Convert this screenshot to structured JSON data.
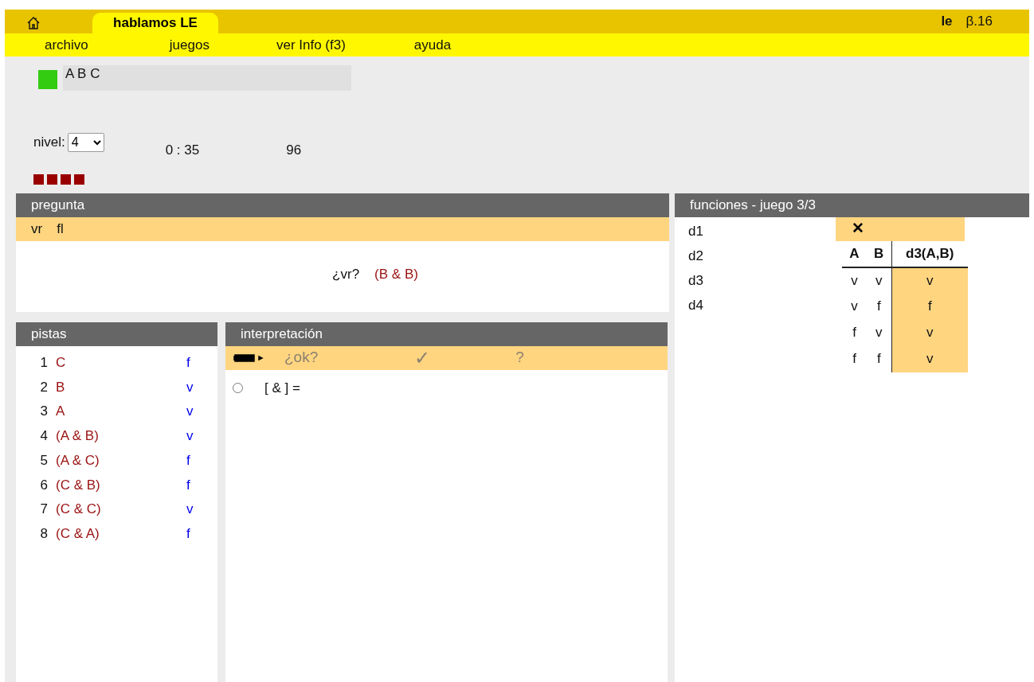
{
  "header": {
    "tabs": [
      {
        "kind": "home",
        "selected": false
      },
      {
        "kind": "text",
        "label": "hablamos LE",
        "selected": true
      }
    ],
    "user": "le",
    "version": "β.16"
  },
  "menu": [
    "archivo",
    "juegos",
    "ver Info (f3)",
    "ayuda"
  ],
  "status": {
    "solved": true,
    "letters": "A B C",
    "nivel_label": "nivel:",
    "nivel": "4",
    "time": "0 : 35",
    "score": "96",
    "squares": [
      {
        "filled": true
      },
      {
        "filled": true
      },
      {
        "filled": true
      },
      {
        "filled": true
      }
    ]
  },
  "pregunta": {
    "title": "pregunta",
    "tabs": [
      "vr",
      "fl"
    ],
    "question": "¿vr?",
    "formula": "(B & B)"
  },
  "pistas": {
    "title": "pistas",
    "items": [
      {
        "n": "1",
        "formula": "C",
        "value": "f"
      },
      {
        "n": "2",
        "formula": "B",
        "value": "v"
      },
      {
        "n": "3",
        "formula": "A",
        "value": "v"
      },
      {
        "n": "4",
        "formula": "(A & B)",
        "value": "v"
      },
      {
        "n": "5",
        "formula": "(A & C)",
        "value": "f"
      },
      {
        "n": "6",
        "formula": "(C & B)",
        "value": "f"
      },
      {
        "n": "7",
        "formula": "(C & C)",
        "value": "v"
      },
      {
        "n": "8",
        "formula": "(C & A)",
        "value": "f"
      }
    ]
  },
  "interpretacion": {
    "title": "interpretación",
    "toolbar": {
      "disabled": true,
      "ok": "¿ok?",
      "check": "✓",
      "help": "?"
    },
    "lines": [
      {
        "text": "[ & ] =",
        "selected": false
      }
    ]
  },
  "funciones": {
    "title": "funciones - juego 3/3",
    "items": [
      "d1",
      "d2",
      "d3",
      "d4"
    ],
    "close": "✕",
    "table": {
      "columns": [
        "A",
        "B",
        "d3(A,B)"
      ],
      "rows": [
        [
          "v",
          "v",
          "v"
        ],
        [
          "v",
          "f",
          "f"
        ],
        [
          "f",
          "v",
          "v"
        ],
        [
          "f",
          "f",
          "v"
        ]
      ]
    }
  }
}
